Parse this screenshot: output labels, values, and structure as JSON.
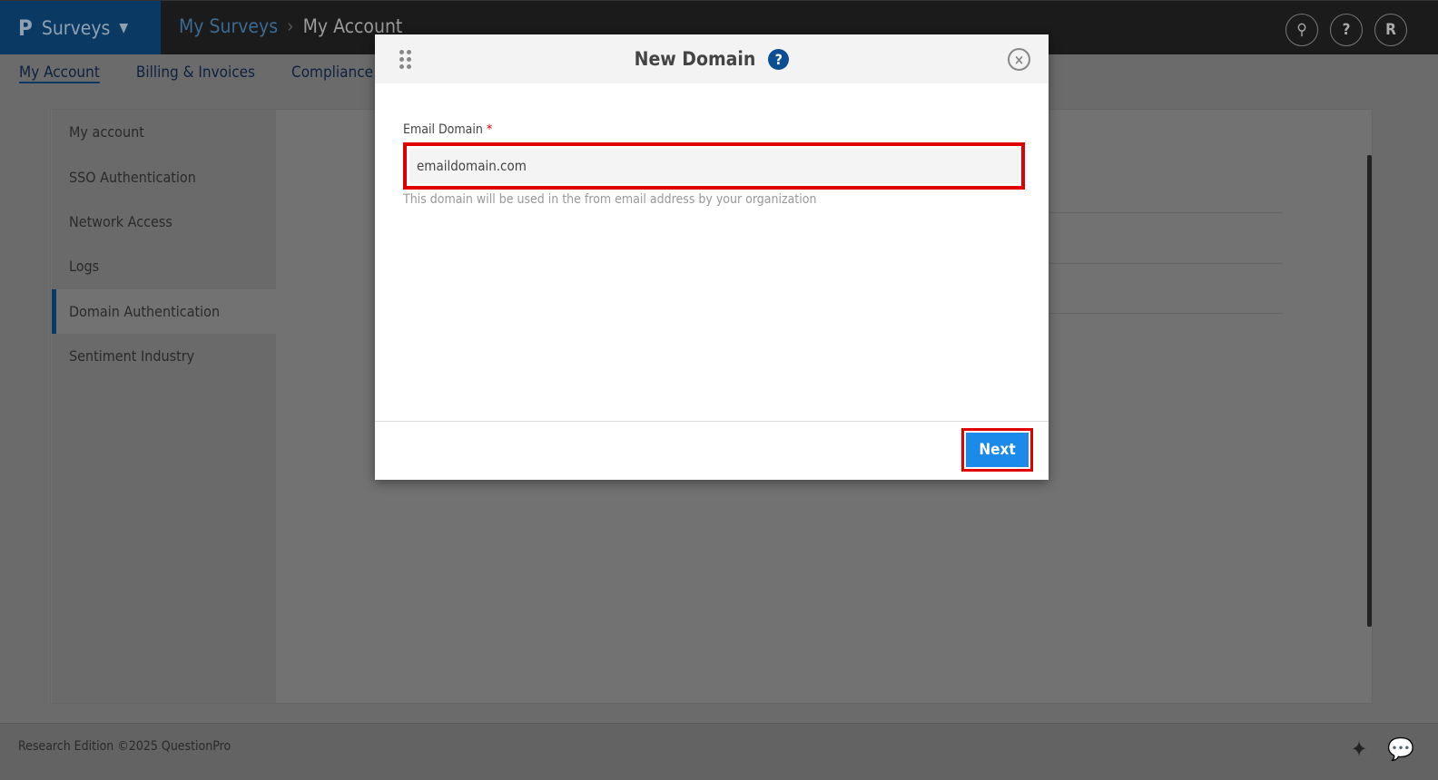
{
  "header": {
    "logo": "P",
    "app": "Surveys",
    "breadcrumb": [
      "My Surveys",
      "My Account"
    ],
    "icons": [
      "search-icon",
      "help-icon"
    ],
    "avatar": "R"
  },
  "tabs": [
    "My Account",
    "Billing & Invoices",
    "Compliance"
  ],
  "sidebar": [
    "My account",
    "SSO Authentication",
    "Network Access",
    "Logs",
    "Domain Authentication",
    "Sentiment Industry"
  ],
  "footer": {
    "text": "Research Edition ©2025 QuestionPro"
  },
  "modal": {
    "title": "New Domain",
    "field_label": "Email Domain",
    "required": "*",
    "field_value": "emaildomain.com",
    "hint": "This domain will be used in the from email address by your organization",
    "next": "Next"
  },
  "colors": {
    "brand": "#0b5da3",
    "primary_button": "#1b8ae8",
    "highlight": "#e00000"
  }
}
